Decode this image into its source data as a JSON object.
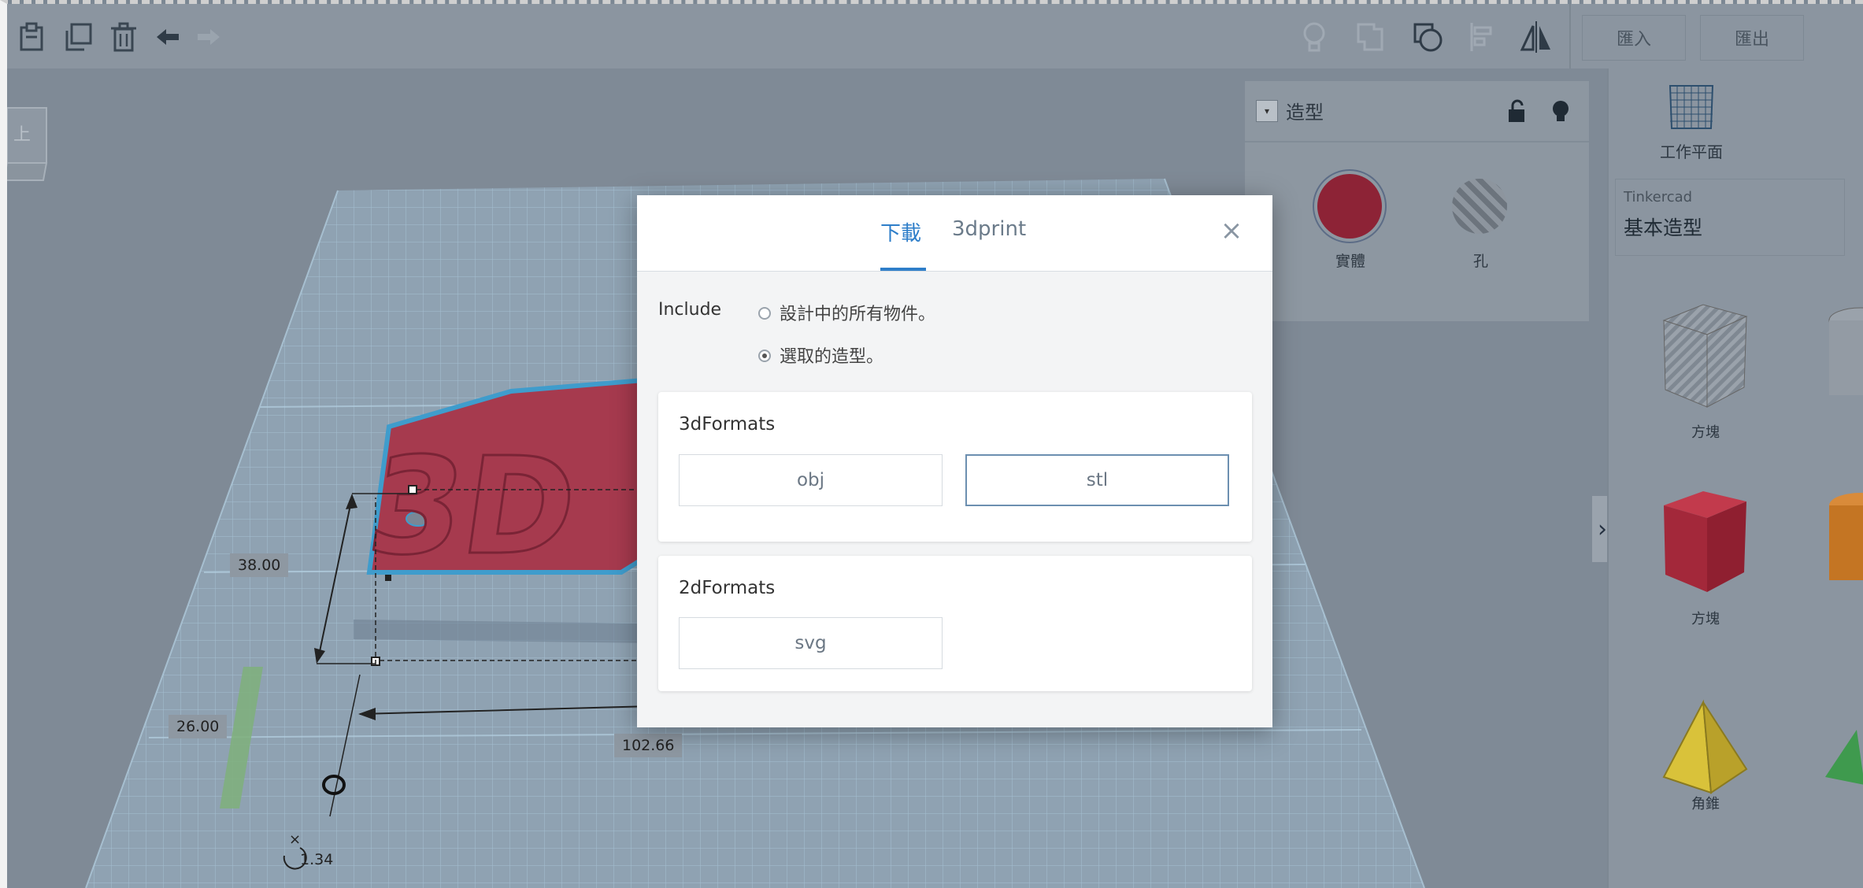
{
  "toolbar": {
    "left_icons": [
      "paste-icon",
      "duplicate-icon",
      "trash-icon",
      "undo-icon",
      "redo-icon"
    ],
    "right_icons": [
      "lightbulb-icon",
      "group-icon",
      "ungroup-icon",
      "align-icon",
      "mirror-icon"
    ],
    "import_label": "匯入",
    "export_label": "匯出"
  },
  "viewcube": {
    "face_label": "上"
  },
  "workspace": {
    "dimensions": {
      "height": "38.00",
      "depth": "26.00",
      "width": "102.66",
      "elevation": "1.34"
    }
  },
  "inspector": {
    "title": "造型",
    "solid_label": "實體",
    "hole_label": "孔",
    "solid_color": "#8d2336"
  },
  "sidebar": {
    "workplane_label": "工作平面",
    "library_source": "Tinkercad",
    "library_name": "基本造型",
    "shapes": [
      {
        "label": "方塊",
        "icon": "striped-box-icon"
      },
      {
        "label": "方塊",
        "icon": "red-box-icon"
      },
      {
        "label": "角錐",
        "icon": "pyramid-icon"
      }
    ]
  },
  "modal": {
    "tabs": [
      {
        "label": "下載",
        "active": true
      },
      {
        "label": "3dprint",
        "active": false
      }
    ],
    "include_label": "Include",
    "include_options": [
      {
        "label": "設計中的所有物件。",
        "selected": false
      },
      {
        "label": "選取的造型。",
        "selected": true
      }
    ],
    "formats_3d": {
      "title": "3dFormats",
      "options": [
        "obj",
        "stl"
      ],
      "selected": "stl"
    },
    "formats_2d": {
      "title": "2dFormats",
      "options": [
        "svg"
      ]
    }
  },
  "colors": {
    "accent": "#2e7ec9",
    "grid_blue": "#a9c9dc"
  }
}
